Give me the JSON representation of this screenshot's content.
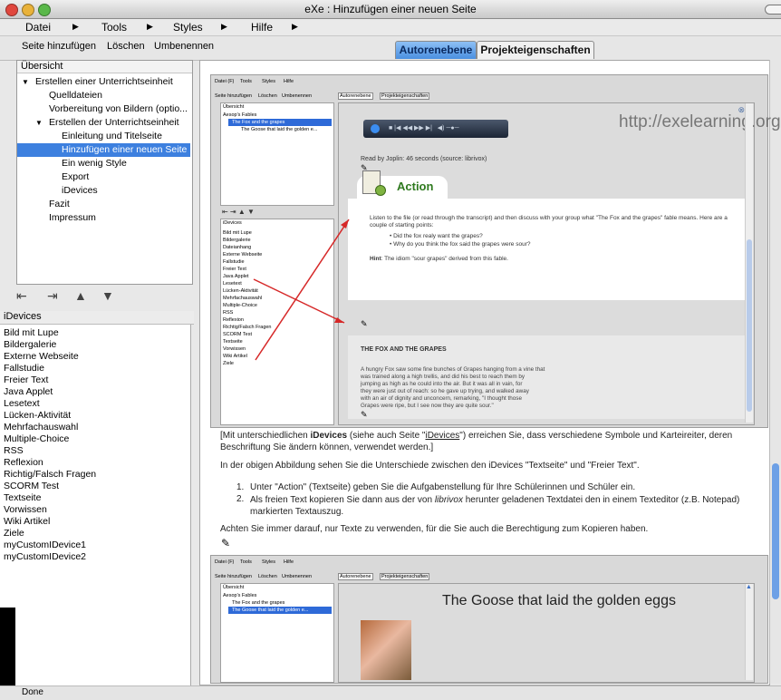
{
  "window": {
    "title": "eXe : Hinzufügen einer neuen Seite"
  },
  "menubar": {
    "items": [
      "Datei",
      "Tools",
      "Styles",
      "Hilfe"
    ]
  },
  "toolbar": {
    "add_page": "Seite hinzufügen",
    "delete": "Löschen",
    "rename": "Umbenennen"
  },
  "tabs": {
    "author": "Autorenebene",
    "project": "Projekteigenschaften"
  },
  "outline": {
    "header": "Übersicht",
    "items": [
      "Erstellen einer Unterrichtseinheit",
      "Quelldateien",
      "Vorbereitung von Bildern (optio...",
      "Erstellen der Unterrichtseinheit",
      "Einleitung und Titelseite",
      "Hinzufügen einer neuen Seite",
      "Ein wenig Style",
      "Export",
      "iDevices",
      "Fazit",
      "Impressum"
    ]
  },
  "idevices": {
    "header": "iDevices",
    "items": [
      "Bild mit Lupe",
      "Bildergalerie",
      "Externe Webseite",
      "Fallstudie",
      "Freier Text",
      "Java Applet",
      "Lesetext",
      "Lücken-Aktivität",
      "Mehrfachauswahl",
      "Multiple-Choice",
      "RSS",
      "Reflexion",
      "Richtig/Falsch Fragen",
      "SCORM Test",
      "Textseite",
      "Vorwissen",
      "Wiki Artikel",
      "Ziele",
      "myCustomIDevice1",
      "myCustomIDevice2"
    ]
  },
  "screenshot1": {
    "menu": [
      "Datei (F)",
      "Tools",
      "Styles",
      "Hilfe"
    ],
    "toolbar": [
      "Seite hinzufügen",
      "Löschen",
      "Umbenennen"
    ],
    "tabs": [
      "Autorenebene",
      "Projekteigenschaften"
    ],
    "outline_header": "Übersicht",
    "outline": [
      "Aesop's Fables",
      "The Fox and the grapes",
      "The Goose that laid the golden e..."
    ],
    "idev_header": "iDevices",
    "idevices": [
      "Bild mit Lupe",
      "Bildergalerie",
      "Dateianhang",
      "Externe Webseite",
      "Fallstudie",
      "Freier Text",
      "Java Applet",
      "Lesetext",
      "Lücken-Aktivität",
      "Mehrfachauswahl",
      "Multiple-Choice",
      "RSS",
      "Reflexion",
      "Richtig/Falsch Fragen",
      "SCORM Test",
      "Textseite",
      "Vorwissen",
      "Wiki Artikel",
      "Ziele"
    ],
    "url": "http://exelearning.org",
    "read_by": "Read by Joplin: 46 seconds (source: librivox)",
    "action_title": "Action",
    "action_text": "Listen to the file (or read through the transcript) and then discuss with your group what \"The Fox and the grapes\" fable means. Here are a couple of starting points:",
    "bullets": [
      "Did the fox realy want the grapes?",
      "Why do you think the fox said the grapes were sour?"
    ],
    "hint_label": "Hint",
    "hint_text": ": The idiom \"sour grapes\" derived from this fable.",
    "story_title": "THE FOX AND THE GRAPES",
    "story_lines": [
      "A hungry Fox saw some fine bunches of Grapes hanging from a vine that",
      "was trained along a high trellis, and did his best to reach them by",
      "jumping as high as he could into the air. But it was all in vain, for",
      "they were just out of reach: so he gave up trying, and walked away",
      "with an air of dignity and unconcern, remarking, \"I thought those",
      "Grapes were ripe, but I see now they are quite sour.\""
    ]
  },
  "content": {
    "para1_a": "[Mit unterschiedlichen ",
    "para1_b": "iDevices",
    "para1_c": " (siehe auch Seite \"",
    "para1_link": "iDevices",
    "para1_d": "\") erreichen Sie, dass verschiedene Symbole und Karteireiter, deren Beschriftung Sie ändern können, verwendet werden.]",
    "para2": "In der obigen Abbildung sehen Sie die Unterschiede zwischen den iDevices \"Textseite\" und \"Freier Text\".",
    "list1_num": "1.",
    "list1": "Unter \"Action\" (Textseite) geben Sie die Aufgabenstellung für Ihre Schülerinnen und Schüler ein.",
    "list2_num": "2.",
    "list2_a": "Als freien Text kopieren Sie dann aus der von ",
    "list2_b": "librivox",
    "list2_c": " herunter geladenen Textdatei den in einem Texteditor (z.B. Notepad) markierten Textauszug.",
    "para3": "Achten Sie immer darauf, nur Texte zu verwenden, für die Sie auch die Berechtigung zum Kopieren haben."
  },
  "screenshot2": {
    "menu": [
      "Datei (F)",
      "Tools",
      "Styles",
      "Hilfe"
    ],
    "toolbar": [
      "Seite hinzufügen",
      "Löschen",
      "Umbenennen"
    ],
    "tabs": [
      "Autorenebene",
      "Projekteigenschaften"
    ],
    "outline_header": "Übersicht",
    "outline": [
      "Aesop's Fables",
      "The Fox and the grapes",
      "The Goose that laid the golden e..."
    ],
    "title": "The Goose that laid the golden eggs"
  },
  "status": {
    "text": "Done"
  },
  "colors": {
    "accent": "#3d80df",
    "action_green": "#2f7a1f",
    "arrow_red": "#d62828"
  }
}
